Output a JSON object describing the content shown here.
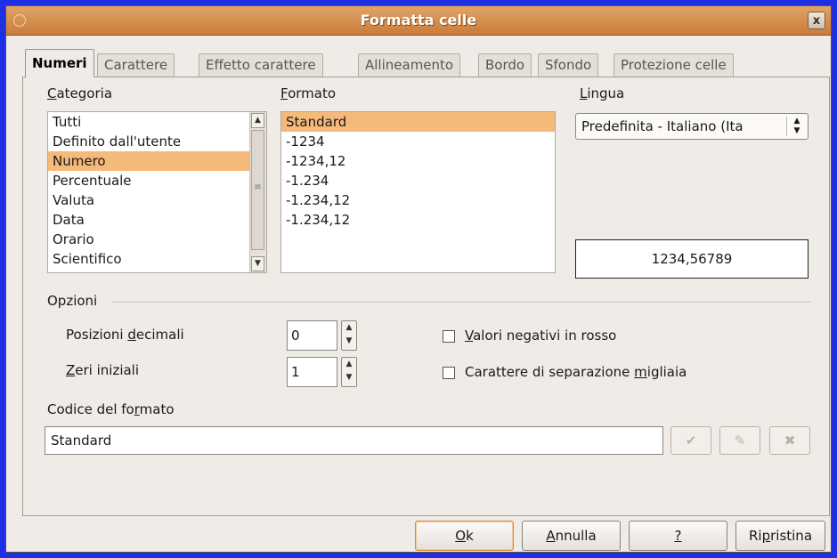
{
  "window": {
    "title": "Formatta celle",
    "close_label": "x"
  },
  "tabs": [
    {
      "label": "Numeri"
    },
    {
      "label": "Carattere"
    },
    {
      "label": "Effetto carattere"
    },
    {
      "label": "Allineamento"
    },
    {
      "label": "Bordo"
    },
    {
      "label": "Sfondo"
    },
    {
      "label": "Protezione celle"
    }
  ],
  "category": {
    "label_prefix": "",
    "label_mnemonic": "C",
    "label_rest": "ategoria",
    "items": [
      "Tutti",
      "Definito dall'utente",
      "Numero",
      "Percentuale",
      "Valuta",
      "Data",
      "Orario",
      "Scientifico"
    ],
    "selected": "Numero"
  },
  "format": {
    "label_mnemonic": "F",
    "label_rest": "ormato",
    "items": [
      "Standard",
      "-1234",
      "-1234,12",
      "-1.234",
      "-1.234,12",
      "-1.234,12"
    ],
    "selected": "Standard"
  },
  "language": {
    "label_mnemonic": "L",
    "label_rest": "ingua",
    "value": "Predefinita - Italiano (Ita"
  },
  "preview": {
    "value": "1234,56789"
  },
  "options": {
    "heading": "Opzioni",
    "decimals": {
      "label_pre": "Posizioni ",
      "label_mnemonic": "d",
      "label_post": "ecimali",
      "value": "0"
    },
    "leading_zeros": {
      "label_mnemonic": "Z",
      "label_post": "eri iniziali",
      "value": "1"
    },
    "negative_red": {
      "label_mnemonic": "V",
      "label_post": "alori negativi in rosso",
      "checked": false
    },
    "thousands_sep": {
      "label_pre": "Carattere di separazione ",
      "label_mnemonic": "m",
      "label_post": "igliaia",
      "checked": false
    }
  },
  "format_code": {
    "label_pre": "Codice del fo",
    "label_mnemonic": "r",
    "label_post": "mato",
    "value": "Standard"
  },
  "buttons": {
    "ok": {
      "mnemonic": "O",
      "rest": "k"
    },
    "cancel": {
      "mnemonic": "A",
      "rest": "nnulla"
    },
    "help": {
      "mnemonic": "?",
      "rest": ""
    },
    "reset": {
      "pre": "Ri",
      "mnemonic": "p",
      "rest": "ristina"
    }
  },
  "colors": {
    "selection": "#f5b97a",
    "titlebar": "#d8914e",
    "desktop": "#1e2fe6"
  }
}
